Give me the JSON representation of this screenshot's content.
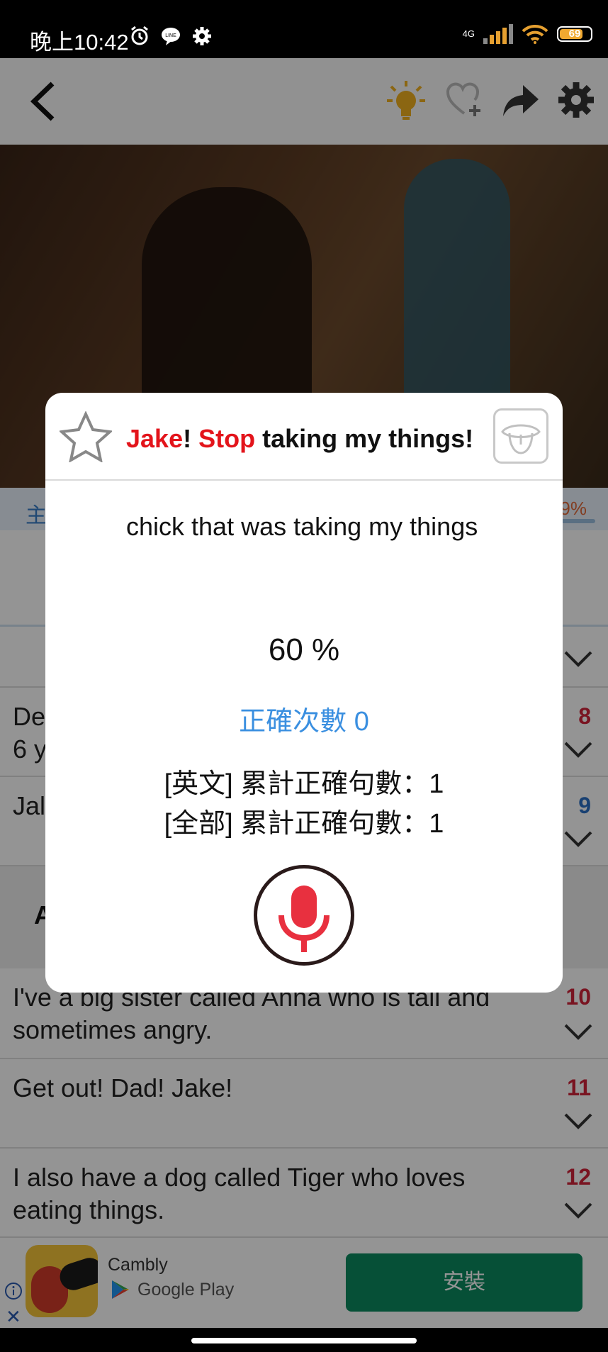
{
  "status_bar": {
    "time": "晚上10:42",
    "network": "4G",
    "battery": "69",
    "battery_level": 0.69
  },
  "app_bar": {
    "icons": [
      "back-arrow-icon",
      "lightbulb-icon",
      "heart-add-icon",
      "share-icon",
      "gear-icon"
    ]
  },
  "tab_bar": {
    "left_label": "主",
    "right_label": "9%"
  },
  "rows": [
    {
      "text": "De\n6 y",
      "number": "8"
    },
    {
      "text": "Jal",
      "number": "9"
    },
    {
      "text": "I've a big sister called Anna who is tall and sometimes angry.",
      "number": "10"
    },
    {
      "text": "Get out! Dad! Jake!",
      "number": "11"
    },
    {
      "text": "I also have a dog called Tiger who loves eating things.",
      "number": "12"
    }
  ],
  "section_letter": "A",
  "dialog": {
    "title_part1": "Jake",
    "title_part2": "! ",
    "title_part3": "Stop",
    "title_part4": " taking my things!",
    "recognized_text": "chick that was taking my things",
    "score": "60 %",
    "correct_count": "正確次數 0",
    "total_english": "[英文] 累計正確句數：1",
    "total_all": "[全部] 累計正確句數：1"
  },
  "ad": {
    "app_name": "Cambly",
    "store": "Google Play",
    "install_label": "安裝"
  },
  "colors": {
    "accent_red": "#e3141b",
    "accent_blue": "#3a8fe0",
    "install_green": "#0b8a5f",
    "mic_red": "#e8303f"
  }
}
